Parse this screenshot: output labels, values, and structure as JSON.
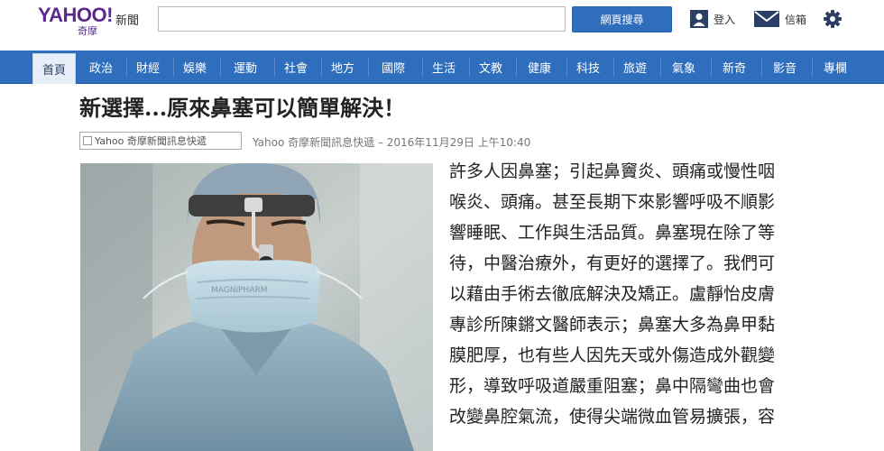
{
  "header": {
    "logo_main": "YAHOO!",
    "logo_sub": "奇摩",
    "section": "新聞",
    "search_placeholder": "",
    "search_button": "網頁搜尋",
    "login_label": "登入",
    "mail_label": "信箱"
  },
  "nav": {
    "items": [
      "首頁",
      "政治",
      "財經",
      "娛樂",
      "運動",
      "社會",
      "地方",
      "國際",
      "生活",
      "文教",
      "健康",
      "科技",
      "旅遊",
      "氣象",
      "新奇",
      "影音",
      "專欄"
    ],
    "active_index": 0
  },
  "article": {
    "title": "新選擇...原來鼻塞可以簡單解決！",
    "source_logo_alt": "Yahoo 奇摩新聞訊息快遞",
    "byline": "Yahoo 奇摩新聞訊息快遞 – 2016年11月29日 上午10:40",
    "body_lines": [
      "許多人因鼻塞；引起鼻竇炎、頭痛或慢性咽",
      "喉炎、頭痛。甚至長期下來影響呼吸不順影",
      "響睡眠、工作與生活品質。鼻塞現在除了等",
      "待，中醫治療外，有更好的選擇了。我們可",
      "以藉由手術去徹底解決及矯正。盧靜怡皮膚",
      "專診所陳鏘文醫師表示；鼻塞大多為鼻甲黏",
      "膜肥厚，也有些人因先天或外傷造成外觀變",
      "形，導致呼吸道嚴重阻塞；鼻中隔彎曲也會",
      "改變鼻腔氣流，使得尖端微血管易擴張，容"
    ]
  },
  "colors": {
    "brand_purple": "#5b2a8c",
    "nav_blue": "#2f6dbd",
    "search_button": "#2f6dbd",
    "active_tab_bg": "#e8eef7"
  }
}
